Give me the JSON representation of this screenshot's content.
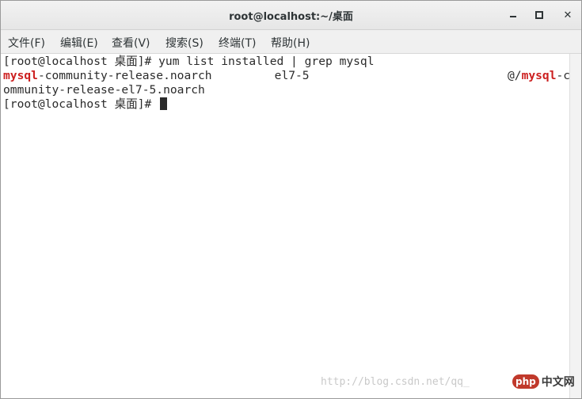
{
  "window": {
    "title": "root@localhost:~/桌面"
  },
  "menu": [
    "文件(F)",
    "编辑(E)",
    "查看(V)",
    "搜索(S)",
    "终端(T)",
    "帮助(H)"
  ],
  "terminal": {
    "line1": "[root@localhost 桌面]# yum list installed | grep mysql",
    "line2_match": "mysql",
    "line2_rest": "-community-release.noarch         el7-5",
    "line2_right_prefix": "@/",
    "line2_right_match": "mysql",
    "line2_right_suffix": "-c",
    "line3": "ommunity-release-el7-5.noarch",
    "prompt": "[root@localhost 桌面]# "
  },
  "watermark": {
    "url": "http://blog.csdn.net/qq_",
    "logo_badge": "php",
    "logo_text": "中文网"
  }
}
